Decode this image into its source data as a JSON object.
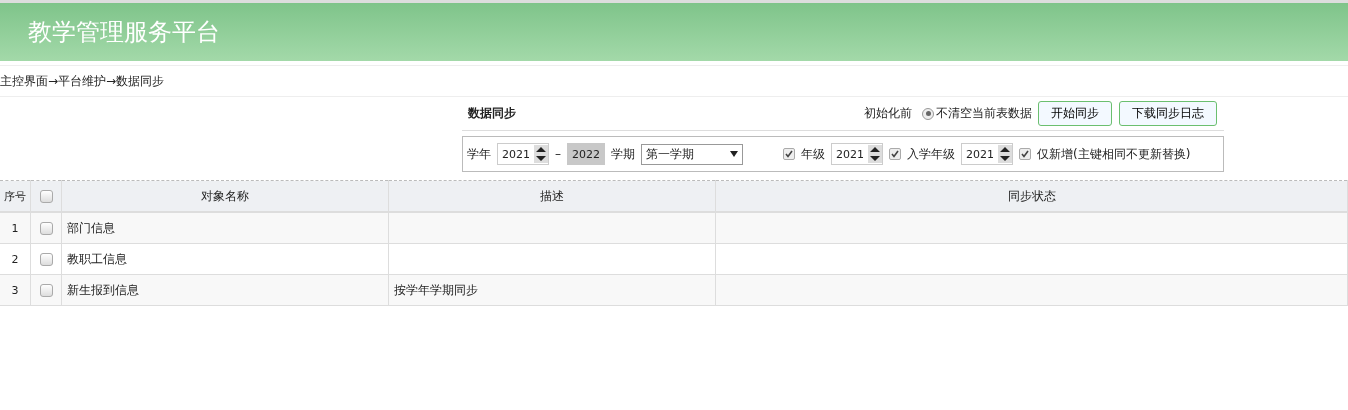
{
  "header": {
    "title": "教学管理服务平台"
  },
  "breadcrumb": "主控界面→平台维护→数据同步",
  "sync_panel": {
    "title": "数据同步",
    "init_label": "初始化前",
    "init_option": {
      "label": "不清空当前表数据",
      "selected": true
    },
    "buttons": [
      "开始同步",
      "下载同步日志"
    ]
  },
  "filters": {
    "year_label": "学年",
    "year_start": "2021",
    "separator": "–",
    "year_end": "2022",
    "term_label": "学期",
    "term": "第一学期",
    "options": [
      {
        "kind": "number",
        "checked": true,
        "label": "年级",
        "value": "2021"
      },
      {
        "kind": "number",
        "checked": true,
        "label": "入学年级",
        "value": "2021"
      },
      {
        "kind": "plain",
        "checked": true,
        "label": "仅新增(主键相同不更新替换)"
      }
    ]
  },
  "table": {
    "columns": [
      "序号",
      "对象名称",
      "描述",
      "同步状态"
    ],
    "select_all_checked": false,
    "rows": [
      {
        "index": "1",
        "checked": false,
        "name": "部门信息"
      },
      {
        "index": "2",
        "checked": false,
        "name": "教职工信息"
      },
      {
        "index": "3",
        "checked": false,
        "name": "新生报到信息",
        "description": "按学年学期同步"
      }
    ]
  }
}
